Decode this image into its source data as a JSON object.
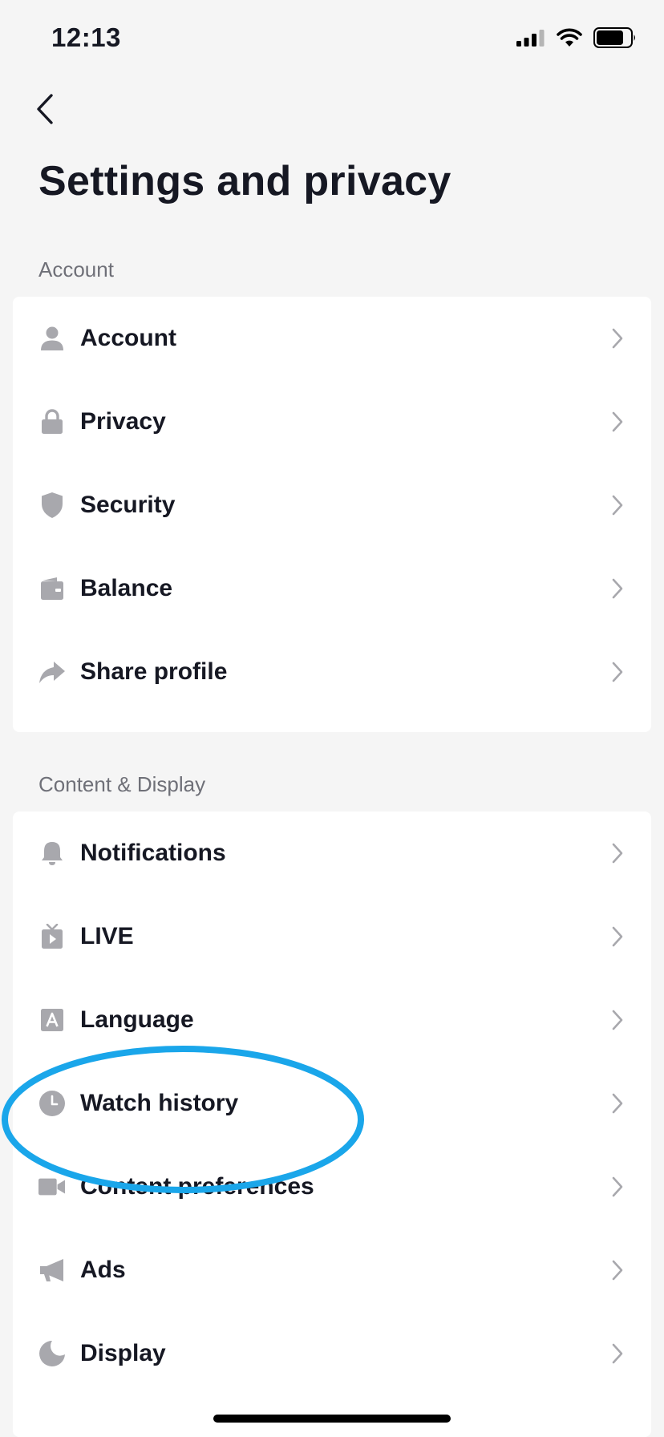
{
  "status_bar": {
    "time": "12:13",
    "icons": [
      "signal-icon",
      "wifi-icon",
      "battery-icon"
    ]
  },
  "header": {
    "back_icon": "chevron-left-icon",
    "title": "Settings and privacy"
  },
  "sections": [
    {
      "label": "Account",
      "items": [
        {
          "label": "Account",
          "icon": "person-icon"
        },
        {
          "label": "Privacy",
          "icon": "lock-icon"
        },
        {
          "label": "Security",
          "icon": "shield-icon"
        },
        {
          "label": "Balance",
          "icon": "wallet-icon"
        },
        {
          "label": "Share profile",
          "icon": "share-icon"
        }
      ]
    },
    {
      "label": "Content & Display",
      "items": [
        {
          "label": "Notifications",
          "icon": "bell-icon"
        },
        {
          "label": "LIVE",
          "icon": "tv-icon"
        },
        {
          "label": "Language",
          "icon": "language-icon"
        },
        {
          "label": "Watch history",
          "icon": "clock-icon"
        },
        {
          "label": "Content preferences",
          "icon": "video-camera-icon"
        },
        {
          "label": "Ads",
          "icon": "megaphone-icon"
        },
        {
          "label": "Display",
          "icon": "moon-icon"
        }
      ]
    }
  ],
  "colors": {
    "background": "#f5f5f5",
    "card": "#ffffff",
    "text": "#161823",
    "section_label": "#6f7078",
    "icon": "#a8a8ad",
    "highlight": "#1aa6ea"
  }
}
